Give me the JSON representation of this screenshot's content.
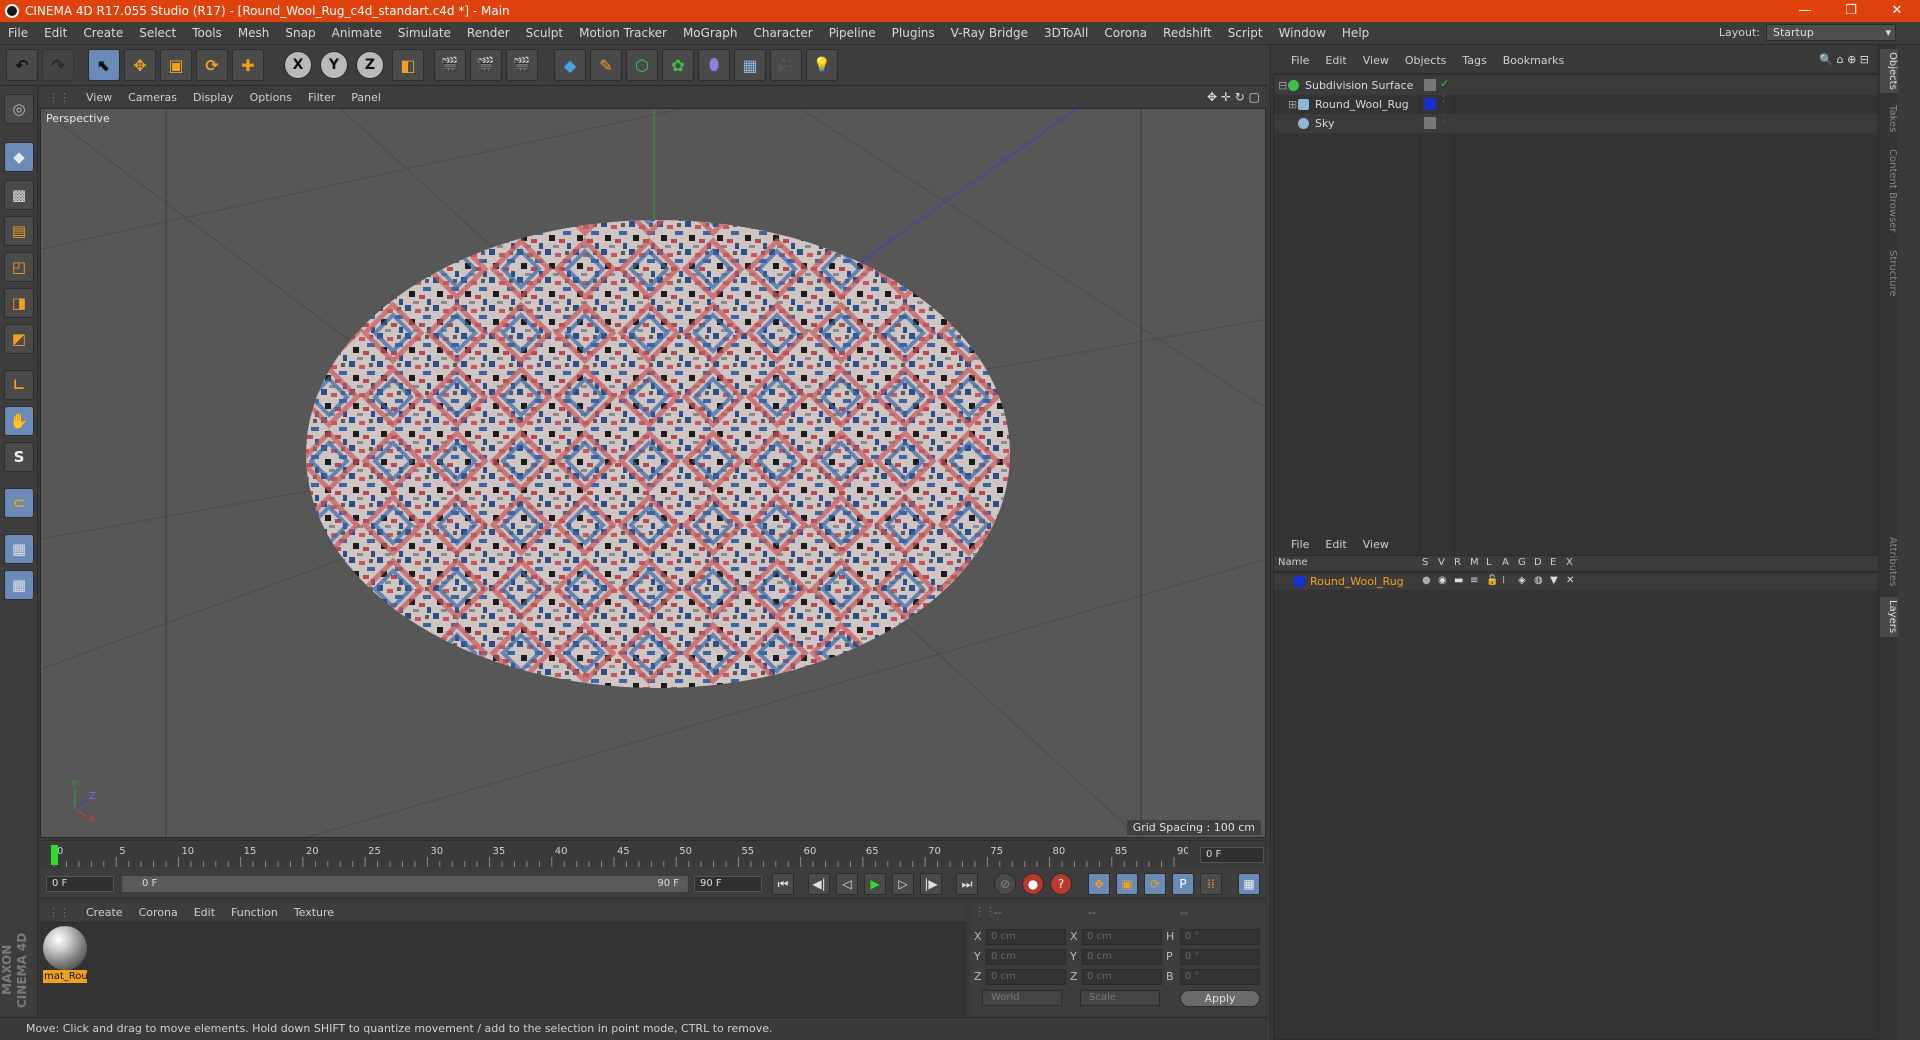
{
  "title": "CINEMA 4D R17.055 Studio (R17) - [Round_Wool_Rug_c4d_standart.c4d *] - Main",
  "window_controls": {
    "minimize": "—",
    "restore": "❐",
    "close": "✕"
  },
  "menu": [
    "File",
    "Edit",
    "Create",
    "Select",
    "Tools",
    "Mesh",
    "Snap",
    "Animate",
    "Simulate",
    "Render",
    "Sculpt",
    "Motion Tracker",
    "MoGraph",
    "Character",
    "Pipeline",
    "Plugins",
    "V-Ray Bridge",
    "3DToAll",
    "Corona",
    "Redshift",
    "Script",
    "Window",
    "Help"
  ],
  "layout": {
    "label": "Layout:",
    "value": "Startup"
  },
  "toolbar": {
    "undo": "↶",
    "redo": "↷",
    "live": "⬉",
    "move": "✥",
    "scale": "▣",
    "rotate": "⟳",
    "add": "✚",
    "x": "X",
    "y": "Y",
    "z": "Z",
    "coord": "◧",
    "render_view": "🎬",
    "render": "🎬",
    "render_settings": "🎬",
    "cube": "◆",
    "pen": "✎",
    "subdiv": "⬡",
    "array": "✿",
    "deform": "⬮",
    "floor": "▦",
    "camera": "🎥",
    "light": "💡"
  },
  "left_tools": [
    "◆",
    "▩",
    "▤",
    "◰",
    "◨",
    "◩",
    "∟",
    "✋",
    "S",
    "⊂",
    "▦",
    "▦"
  ],
  "viewport": {
    "menu": [
      "View",
      "Cameras",
      "Display",
      "Options",
      "Filter",
      "Panel"
    ],
    "nav_icons": "✥ ✛ ↻ ▢",
    "label": "Perspective",
    "grid_spacing": "Grid Spacing : 100 cm",
    "axis": {
      "y": "Y",
      "z": "Z",
      "x": "X"
    }
  },
  "timeline": {
    "ticks": [
      "0",
      "5",
      "10",
      "15",
      "20",
      "25",
      "30",
      "35",
      "40",
      "45",
      "50",
      "55",
      "60",
      "65",
      "70",
      "75",
      "80",
      "85",
      "90"
    ],
    "current_frame": "0 F",
    "start": "0 F",
    "range_left": "0 F",
    "range_right": "90 F",
    "end": "90 F",
    "buttons": [
      "⏮",
      "◀|",
      "◁",
      "▶",
      "▷",
      "|▶",
      "⏭"
    ]
  },
  "materials": {
    "menu": [
      "Create",
      "Corona",
      "Edit",
      "Function",
      "Texture"
    ],
    "items": [
      {
        "label": "mat_Rou"
      }
    ]
  },
  "coordinates": {
    "headers": [
      "--",
      "--",
      "--"
    ],
    "rows": [
      {
        "l1": "X",
        "v1": "0 cm",
        "l2": "X",
        "v2": "0 cm",
        "l3": "H",
        "v3": "0 °"
      },
      {
        "l1": "Y",
        "v1": "0 cm",
        "l2": "Y",
        "v2": "0 cm",
        "l3": "P",
        "v3": "0 °"
      },
      {
        "l1": "Z",
        "v1": "0 cm",
        "l2": "Z",
        "v2": "0 cm",
        "l3": "B",
        "v3": "0 °"
      }
    ],
    "mode": "World",
    "type": "Scale",
    "apply": "Apply"
  },
  "objects": {
    "menu": [
      "File",
      "Edit",
      "View",
      "Objects",
      "Tags",
      "Bookmarks"
    ],
    "icons": "🔍 ⌂ ⊕ ⊟",
    "items": [
      {
        "name": "Subdivision Surface",
        "icon_color": "#3fc24a"
      },
      {
        "name": "Round_Wool_Rug",
        "icon_color": "#8fb7d9"
      },
      {
        "name": "Sky",
        "icon_color": "#8fb7d9"
      }
    ]
  },
  "layers": {
    "menu": [
      "File",
      "Edit",
      "View"
    ],
    "columns": [
      "Name",
      "S",
      "V",
      "R",
      "M",
      "L",
      "A",
      "G",
      "D",
      "E",
      "X"
    ],
    "items": [
      {
        "name": "Round_Wool_Rug",
        "color": "#1a2fd0"
      }
    ]
  },
  "side_tabs": [
    "Objects",
    "Takes",
    "Content Browser",
    "Structure",
    "Attributes",
    "Layers"
  ],
  "status": "Move: Click and drag to move elements. Hold down SHIFT to quantize movement / add to the selection in point mode, CTRL to remove.",
  "branding": "MAXON CINEMA 4D"
}
